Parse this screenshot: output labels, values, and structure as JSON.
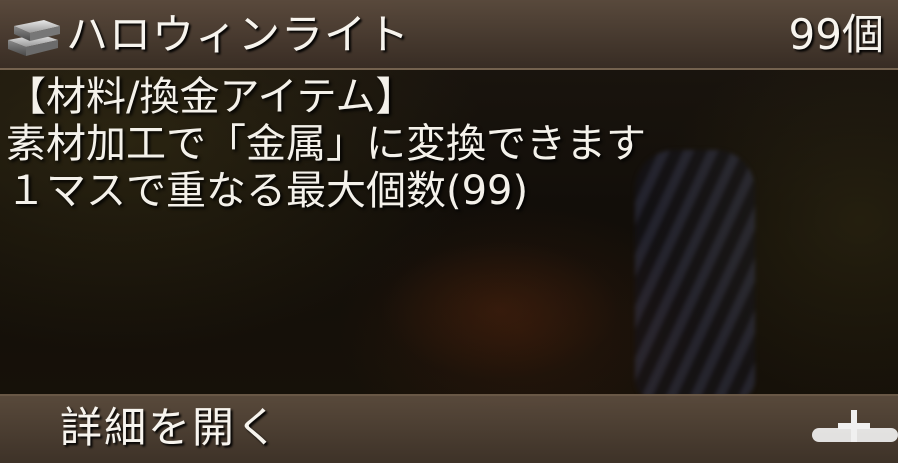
{
  "item": {
    "name": "ハロウィンライト",
    "count": "99個",
    "icon": "metal-ingot-icon"
  },
  "description": {
    "lines": [
      "【材料/換金アイテム】",
      "素材加工で「金属」に変換できます",
      "１マスで重なる最大個数(99)"
    ]
  },
  "footer": {
    "detail_label": "詳細を開く",
    "expand_icon": "plus-icon"
  },
  "colors": {
    "bar": "#5a4a3d",
    "text": "#f7f4ee",
    "background": "#120e09"
  }
}
